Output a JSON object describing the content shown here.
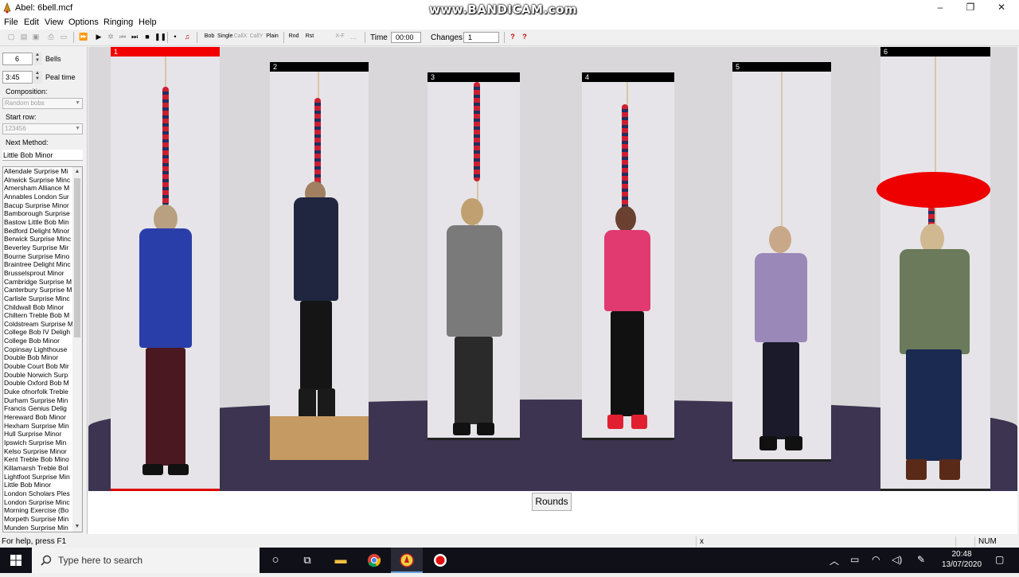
{
  "window": {
    "title": "Abel: 6bell.mcf",
    "watermark": "www.BANDICAM.com"
  },
  "menu": [
    "File",
    "Edit",
    "View",
    "Options",
    "Ringing",
    "Help"
  ],
  "toolbar": {
    "labels": [
      "Bob",
      "Single",
      "CallX",
      "CallY",
      "Plain",
      "Rnd",
      "Rst",
      "X-F"
    ],
    "time_label": "Time",
    "time_value": "00:00",
    "changes_label": "Changes",
    "changes_value": "1"
  },
  "left": {
    "bells_value": "6",
    "bells_label": "Bells",
    "peal_time_value": "3:45",
    "peal_time_label": "Peal time",
    "composition_label": "Composition:",
    "composition_value": "Random bobs",
    "start_row_label": "Start row:",
    "start_row_value": "123456",
    "next_method_label": "Next Method:",
    "next_method_value": "Little Bob Minor",
    "methods": [
      "Allendale Surprise Mi",
      "Alnwick Surprise Minc",
      "Amersham Alliance M",
      "Annables London Sur",
      "Bacup Surprise Minor",
      "Bamborough Surprise",
      "Bastow Little Bob Min",
      "Bedford Delight Minor",
      "Berwick Surprise Minc",
      "Beverley Surprise Mir",
      "Bourne Surprise Mino",
      "Braintree Delight Minc",
      "Brusselsprout Minor",
      "Cambridge Surprise M",
      "Canterbury Surprise M",
      "Carlisle Surprise Minc",
      "Childwall Bob Minor",
      "Chiltern Treble Bob M",
      "Coldstream Surprise M",
      "College Bob IV Deligh",
      "College Bob Minor",
      "Copinsay Lighthouse",
      "Double Bob Minor",
      "Double Court Bob Mir",
      "Double Norwich Surp",
      "Double Oxford Bob M",
      "Duke ofnorfolk Treble",
      "Durham Surprise Min",
      "Francis Genius Delig",
      "Hereward Bob Minor",
      "Hexham Surprise Min",
      "Hull Surprise Minor",
      "Ipswich Surprise Min",
      "Kelso Surprise Minor",
      "Kent Treble Bob Mino",
      "Killamarsh Treble Bol",
      "Lightfoot Surprise Min",
      "Little Bob Minor",
      "London Scholars Ples",
      "London Surprise Minc",
      "Morning Exercise (Bo",
      "Morpeth Surprise Min",
      "Munden Surprise Min"
    ]
  },
  "bells": [
    {
      "number": "1",
      "active": true
    },
    {
      "number": "2",
      "active": false
    },
    {
      "number": "3",
      "active": false
    },
    {
      "number": "4",
      "active": false
    },
    {
      "number": "5",
      "active": false
    },
    {
      "number": "6",
      "active": false
    }
  ],
  "rounds_button": "Rounds",
  "status": {
    "help": "For help, press F1",
    "cell_x": "x",
    "num": "NUM"
  },
  "taskbar": {
    "search_placeholder": "Type here to search",
    "time": "20:48",
    "date": "13/07/2020"
  },
  "colors": {
    "active_bar": "#f20000",
    "signal": "#ee0000",
    "floor": "#3c3450"
  }
}
